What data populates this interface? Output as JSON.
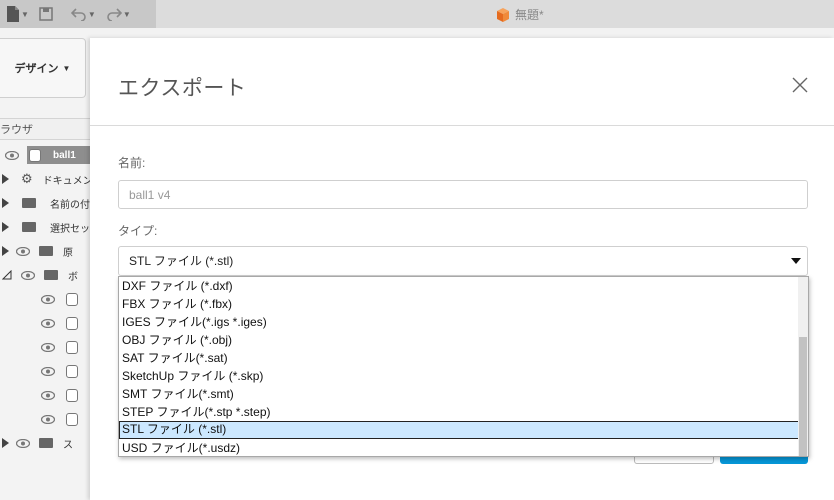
{
  "doc_title": "無題*",
  "workspace": {
    "label": "デザイン"
  },
  "browser": {
    "label": "ラウザ",
    "items": [
      {
        "label": "ball1",
        "selected": true
      },
      {
        "label": "ドキュメン"
      },
      {
        "label": "名前の付"
      },
      {
        "label": "選択セッ"
      },
      {
        "label": "原"
      },
      {
        "label": "ボ"
      },
      {
        "label": ""
      },
      {
        "label": ""
      },
      {
        "label": ""
      },
      {
        "label": ""
      },
      {
        "label": ""
      },
      {
        "label": ""
      },
      {
        "label": "ス"
      }
    ]
  },
  "dialog": {
    "title": "エクスポート",
    "name_label": "名前:",
    "name_value": "ball1 v4",
    "type_label": "タイプ:",
    "type_selected": "STL ファイル (*.stl)",
    "options": [
      "DXF ファイル (*.dxf)",
      "FBX ファイル (*.fbx)",
      "IGES ファイル(*.igs *.iges)",
      "OBJ ファイル (*.obj)",
      "SAT ファイル(*.sat)",
      "SketchUp ファイル (*.skp)",
      "SMT ファイル(*.smt)",
      "STEP ファイル(*.stp *.step)",
      "STL ファイル (*.stl)",
      "USD ファイル(*.usdz)"
    ],
    "selected_index": 8
  },
  "colors": {
    "accent": "#0696d7",
    "selection": "#cce8ff"
  },
  "icons": [
    "file-icon",
    "save-icon",
    "undo-icon",
    "redo-icon",
    "cube-icon",
    "close-icon",
    "eye-icon",
    "gear-icon",
    "folder-icon",
    "body-icon",
    "chevron-down-icon"
  ]
}
